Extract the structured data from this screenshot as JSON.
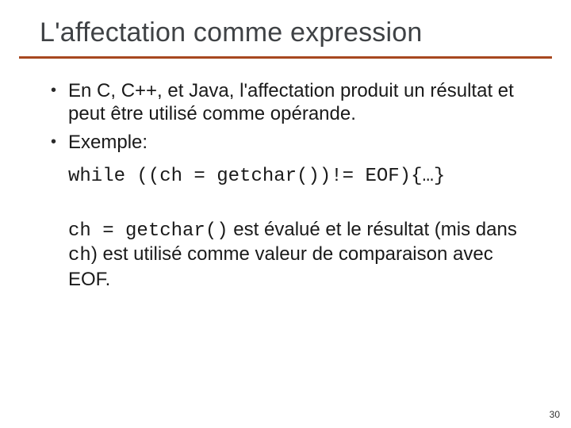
{
  "title": "L'affectation comme expression",
  "bullets": [
    "En C, C++, et Java, l'affectation produit un résultat et peut être utilisé comme opérande.",
    "Exemple:"
  ],
  "code_example": "while ((ch = getchar())!= EOF){…}",
  "explanation": {
    "code1": "ch = getchar()",
    "text1": " est évalué et le résultat (mis dans ",
    "code2": "ch",
    "text2": ") est utilisé comme valeur de comparaison avec EOF."
  },
  "page_number": "30"
}
